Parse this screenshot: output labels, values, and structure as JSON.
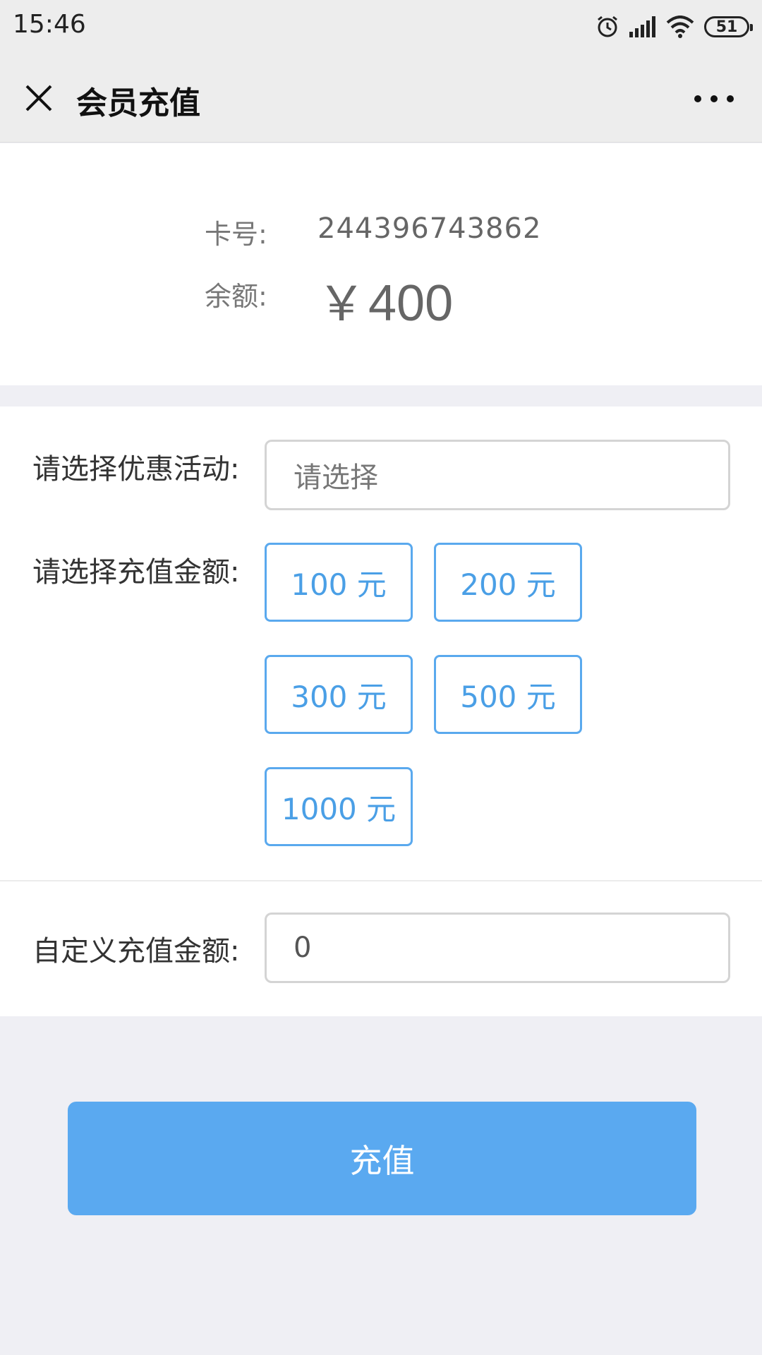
{
  "status_bar": {
    "time": "15:46",
    "battery": "51",
    "icons": [
      "alarm-icon",
      "signal-icon",
      "wifi-icon",
      "battery-icon"
    ]
  },
  "nav": {
    "title": "会员充值",
    "close_icon": "close-icon",
    "more_icon": "more-icon"
  },
  "card": {
    "card_no_label": "卡号:",
    "card_no": "244396743862",
    "balance_label": "余额:",
    "currency": "￥",
    "balance": "400"
  },
  "promotion": {
    "label": "请选择优惠活动:",
    "placeholder": "请选择"
  },
  "amounts": {
    "label": "请选择充值金额:",
    "options": [
      "100 元",
      "200 元",
      "300 元",
      "500 元",
      "1000 元"
    ]
  },
  "custom": {
    "label": "自定义充值金额:",
    "value": "0"
  },
  "submit_label": "充值",
  "colors": {
    "accent": "#5aa9f0",
    "button_border": "#5aa9ee",
    "background": "#efeff4"
  }
}
